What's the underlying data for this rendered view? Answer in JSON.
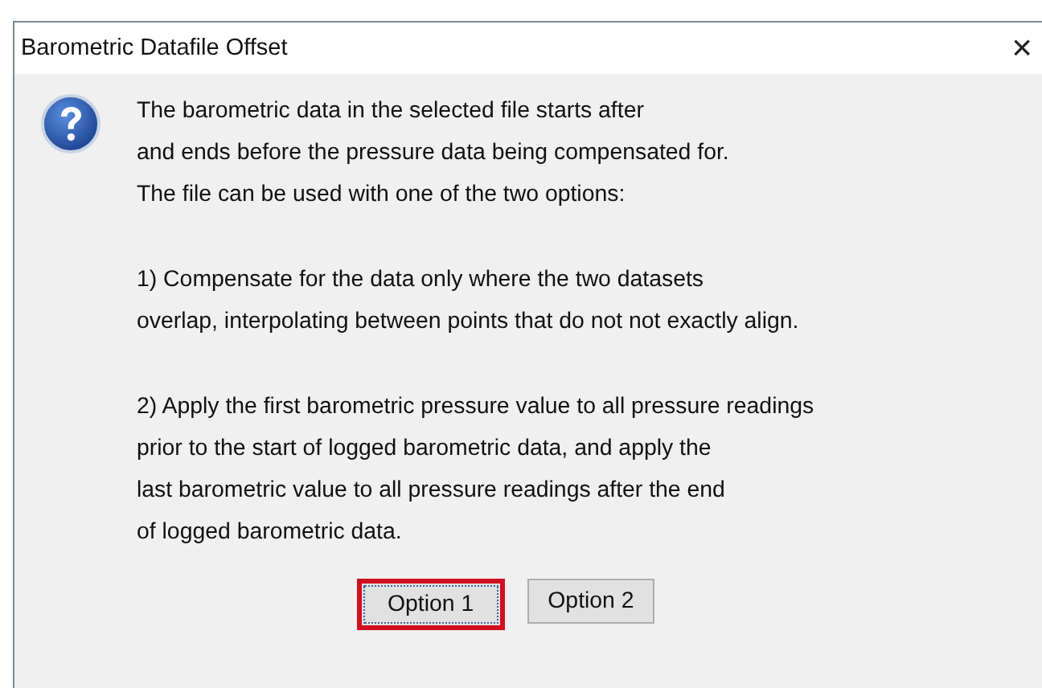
{
  "window": {
    "title": "Barometric Datafile Offset",
    "close": "×"
  },
  "message": [
    [
      "The barometric data in the selected file starts after",
      "and ends before the pressure data being compensated for.",
      "The file can be used with one of the two options:"
    ],
    [
      "1) Compensate for the data only where the two datasets",
      "overlap, interpolating between points that do not not exactly align."
    ],
    [
      "2) Apply the first barometric pressure value to all pressure readings",
      "prior to the start of logged barometric data, and apply the",
      "last barometric value to all pressure readings after the end",
      "of logged barometric data."
    ]
  ],
  "buttons": [
    {
      "label": "Option 1",
      "selected": true
    },
    {
      "label": "Option 2",
      "selected": false
    }
  ]
}
